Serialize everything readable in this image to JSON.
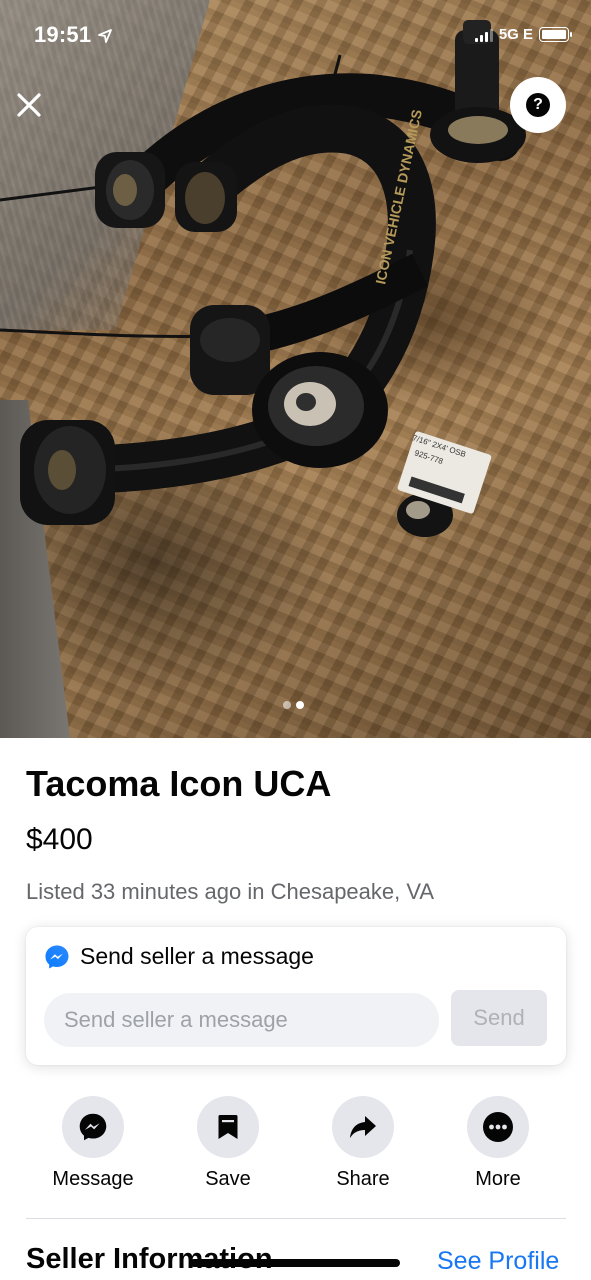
{
  "status_bar": {
    "time": "19:51",
    "network": "5G E"
  },
  "photo": {
    "printed_text": [
      "ICON VEHICLE DYNAMICS",
      "7/16\" 2X4' OSB",
      "925-778"
    ],
    "page_count": 2,
    "active_page": 2
  },
  "listing": {
    "title": "Tacoma Icon UCA",
    "price": "$400",
    "listed": "Listed 33 minutes ago in Chesapeake, VA"
  },
  "message_card": {
    "heading": "Send seller a message",
    "input_placeholder": "Send seller a message",
    "send_label": "Send"
  },
  "actions": [
    {
      "label": "Message",
      "icon": "messenger-icon"
    },
    {
      "label": "Save",
      "icon": "bookmark-icon"
    },
    {
      "label": "Share",
      "icon": "share-arrow-icon"
    },
    {
      "label": "More",
      "icon": "more-dots-icon"
    }
  ],
  "seller": {
    "title": "Seller Information",
    "link": "See Profile"
  },
  "colors": {
    "accent": "#1877f2",
    "secondary_text": "#65676b",
    "button_bg": "#e4e6eb"
  }
}
